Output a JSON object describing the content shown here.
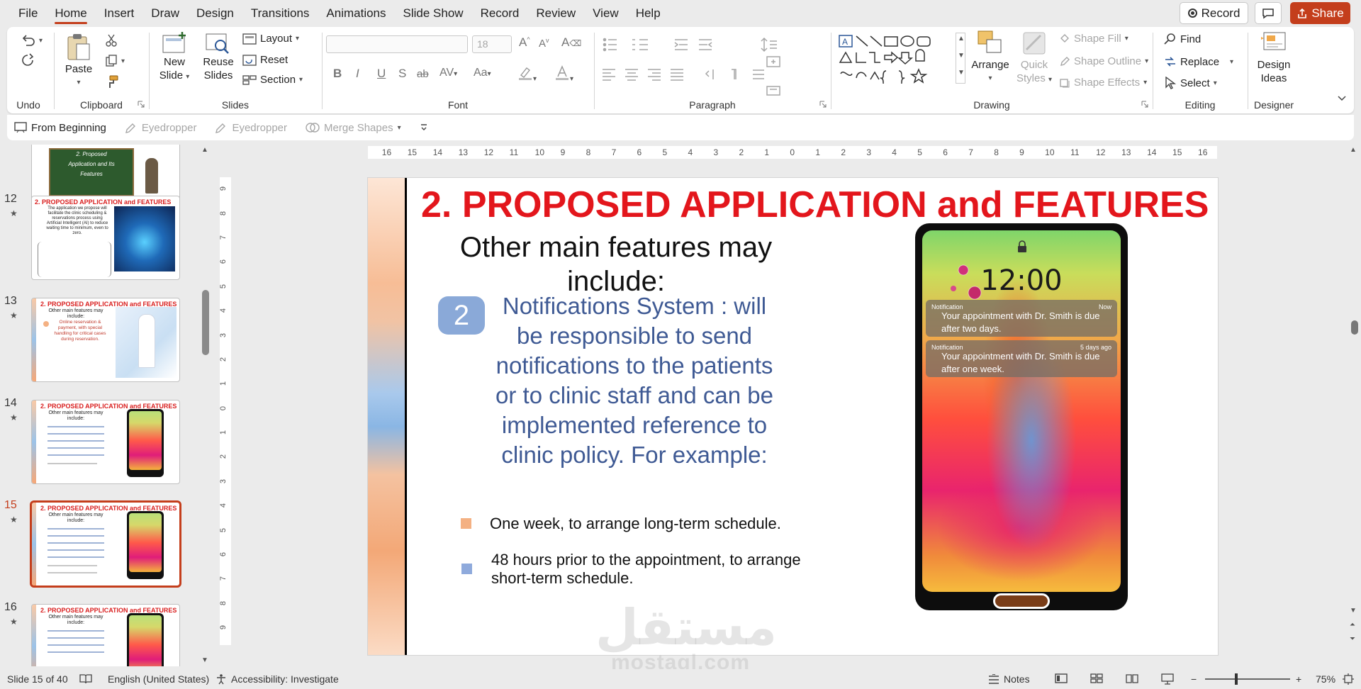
{
  "menu": {
    "tabs": [
      "File",
      "Home",
      "Insert",
      "Draw",
      "Design",
      "Transitions",
      "Animations",
      "Slide Show",
      "Record",
      "Review",
      "View",
      "Help"
    ],
    "active": "Home",
    "record_label": "Record",
    "share_label": "Share"
  },
  "ribbon": {
    "undo": {
      "group": "Undo"
    },
    "clipboard": {
      "group": "Clipboard",
      "paste": "Paste"
    },
    "slides": {
      "group": "Slides",
      "new_slide": "New",
      "new_slide2": "Slide",
      "reuse": "Reuse",
      "reuse2": "Slides",
      "layout": "Layout",
      "reset": "Reset",
      "section": "Section"
    },
    "font": {
      "group": "Font",
      "size": "18",
      "bold": "B",
      "italic": "I",
      "underline": "U",
      "strike": "S",
      "abc": "ab",
      "spacing": "AV",
      "case": "Aa"
    },
    "paragraph": {
      "group": "Paragraph"
    },
    "drawing": {
      "group": "Drawing",
      "arrange": "Arrange",
      "quick_styles": "Quick",
      "quick_styles2": "Styles",
      "shape_fill": "Shape Fill",
      "shape_outline": "Shape Outline",
      "shape_effects": "Shape Effects"
    },
    "editing": {
      "group": "Editing",
      "find": "Find",
      "replace": "Replace",
      "select": "Select"
    },
    "designer": {
      "group": "Designer",
      "design_ideas": "Design",
      "design_ideas2": "Ideas"
    }
  },
  "qat": {
    "from_beginning": "From Beginning",
    "eyedropper1": "Eyedropper",
    "eyedropper2": "Eyedropper",
    "merge_shapes": "Merge Shapes"
  },
  "thumbnails": [
    {
      "num": "",
      "title_lines": [
        "2. Proposed",
        "Application and Its",
        "Features"
      ]
    },
    {
      "num": "12",
      "title": "2. PROPOSED APPLICATION and FEATURES",
      "text": "The application we propose will facilitate the clinic scheduling & reservations process using Artificial Intelligent (AI) to reduce waiting time to minimum, even to zero."
    },
    {
      "num": "13",
      "title": "2. PROPOSED APPLICATION and FEATURES",
      "text": "Other main features may include:",
      "text2": "Online reservation & payment, with special handling for critical cases during reservation."
    },
    {
      "num": "14",
      "title": "2. PROPOSED APPLICATION and FEATURES",
      "text": "Other main features may include:"
    },
    {
      "num": "15",
      "title": "2. PROPOSED APPLICATION and FEATURES",
      "text": "Other main features may include:"
    },
    {
      "num": "16",
      "title": "2. PROPOSED APPLICATION and FEATURES",
      "text": "Other main features may include:"
    }
  ],
  "ruler": {
    "h_ticks": [
      "16",
      "15",
      "14",
      "13",
      "12",
      "11",
      "10",
      "9",
      "8",
      "7",
      "6",
      "5",
      "4",
      "3",
      "2",
      "1",
      "0",
      "1",
      "2",
      "3",
      "4",
      "5",
      "6",
      "7",
      "8",
      "9",
      "10",
      "11",
      "12",
      "13",
      "14",
      "15",
      "16"
    ],
    "v_ticks": [
      "9",
      "8",
      "7",
      "6",
      "5",
      "4",
      "3",
      "2",
      "1",
      "0",
      "1",
      "2",
      "3",
      "4",
      "5",
      "6",
      "7",
      "8",
      "9"
    ]
  },
  "slide": {
    "title": "2. PROPOSED APPLICATION and FEATURES",
    "subtitle": "Other main features may include:",
    "badge": "2",
    "body": "Notifications System : will be responsible to send notifications to the patients  or to  clinic staff  and can be implemented reference to clinic policy. For example:",
    "bullets": [
      {
        "text": "One week, to  arrange long-term schedule.",
        "color": "#f4b183"
      },
      {
        "text": "48 hours prior to the appointment, to arrange short-term schedule.",
        "color": "#8faadc"
      }
    ],
    "phone": {
      "time": "12:00",
      "notifications": [
        {
          "header": "Notification",
          "time": "Now",
          "message": "Your appointment with Dr. Smith is due after two days."
        },
        {
          "header": "Notification",
          "time": "5 days ago",
          "message": "Your appointment with Dr. Smith is due after one week."
        }
      ]
    },
    "watermark_arabic": "مستقل",
    "watermark_latin": "mostaql.com"
  },
  "status": {
    "slide_of": "Slide 15 of 40",
    "language": "English (United States)",
    "accessibility": "Accessibility: Investigate",
    "notes": "Notes",
    "zoom": "75%"
  },
  "colors": {
    "accent": "#c43e1c",
    "title_red": "#e3161c",
    "body_blue": "#3f5a94",
    "badge": "#8aa9d8"
  }
}
